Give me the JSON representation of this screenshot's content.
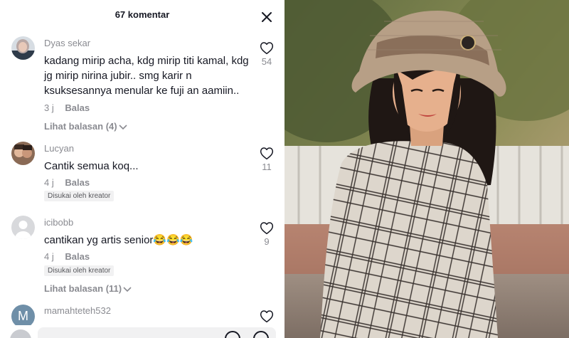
{
  "header": {
    "title": "67 komentar"
  },
  "comments": [
    {
      "username": "Dyas sekar",
      "text": "kadang mirip acha, kdg mirip titi kamal, kdg jg mirip nirina jubir.. smg karir n ksuksesannya menular ke fuji an aamiin..",
      "time": "3 j",
      "reply_label": "Balas",
      "likes": "54",
      "view_replies": "Lihat balasan (4)"
    },
    {
      "username": "Lucyan",
      "text": "Cantik semua koq...",
      "time": "4 j",
      "reply_label": "Balas",
      "likes": "11",
      "badge": "Disukai oleh kreator"
    },
    {
      "username": "icibobb",
      "text": "cantikan yg artis senior😂😂😂",
      "time": "4 j",
      "reply_label": "Balas",
      "likes": "9",
      "badge": "Disukai oleh kreator",
      "view_replies": "Lihat balasan (11)"
    },
    {
      "username": "mamahteteh532",
      "avatar_letter": "M"
    }
  ],
  "colors": {
    "text": "#161823",
    "muted": "#8a8b91",
    "badge_bg": "#f1f1f2"
  },
  "icons": {
    "close": "close-icon",
    "like": "heart-outline-icon",
    "chevron": "chevron-down-icon"
  }
}
